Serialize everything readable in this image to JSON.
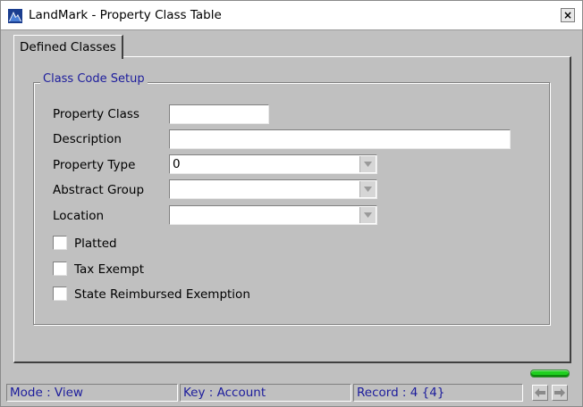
{
  "window": {
    "title": "LandMark - Property Class Table",
    "close_glyph": "×"
  },
  "tabs": [
    {
      "label": "Defined Classes",
      "selected": true
    }
  ],
  "group": {
    "legend": "Class Code Setup"
  },
  "fields": {
    "property_class": {
      "label": "Property Class",
      "value": ""
    },
    "description": {
      "label": "Description",
      "value": ""
    },
    "property_type": {
      "label": "Property Type",
      "value": "0"
    },
    "abstract_group": {
      "label": "Abstract Group",
      "value": ""
    },
    "location": {
      "label": "Location",
      "value": ""
    }
  },
  "checkboxes": [
    {
      "label": "Platted",
      "checked": false
    },
    {
      "label": "Tax Exempt",
      "checked": false
    },
    {
      "label": "State Reimbursed Exemption",
      "checked": false
    }
  ],
  "status_bar": {
    "mode": "Mode : View",
    "key": "Key : Account",
    "record": "Record : 4 {4}"
  },
  "icons": {
    "app": "landmark-app-icon",
    "dropdown": "chevron-down-icon",
    "prev": "arrow-left-icon",
    "next": "arrow-right-icon",
    "indicator": "status-indicator"
  },
  "colors": {
    "legend_text": "#1c1c9c",
    "status_text": "#1c1c9c",
    "indicator": "#1fcf1f",
    "background": "#c0c0c0"
  }
}
